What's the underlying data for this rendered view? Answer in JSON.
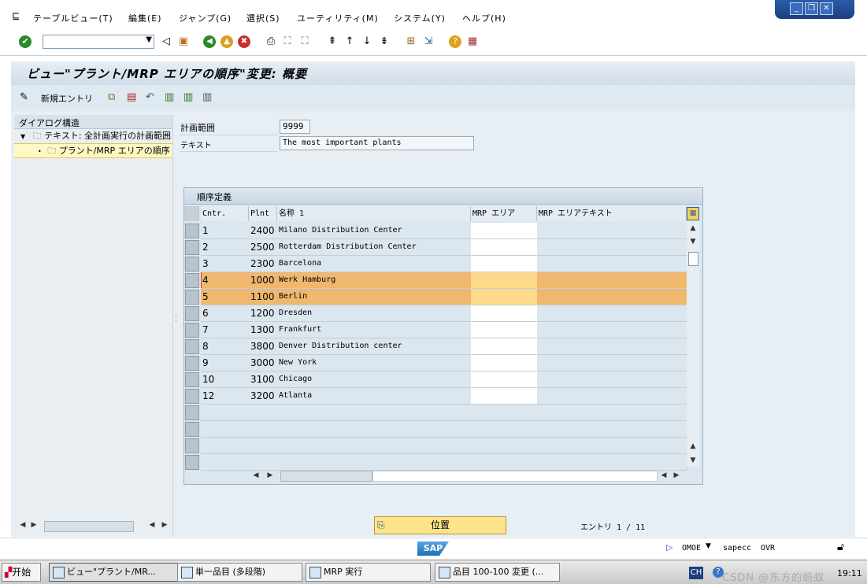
{
  "menu": {
    "items": [
      "テーブルビュー(T)",
      "編集(E)",
      "ジャンプ(G)",
      "選択(S)",
      "ユーティリティ(M)",
      "システム(Y)",
      "ヘルプ(H)"
    ]
  },
  "window_controls": {
    "minimize": "_",
    "restore": "❐",
    "close": "✕"
  },
  "title": "ビュー\"プラント/MRP エリアの順序\"変更: 概要",
  "app_toolbar": {
    "new_entries": "新規エントリ"
  },
  "tree": {
    "header": "ダイアログ構造",
    "items": [
      {
        "label": "テキスト: 全計画実行の計画範囲"
      },
      {
        "label": "プラント/MRP エリアの順序"
      }
    ]
  },
  "fields": {
    "plan_area_label": "計画範囲",
    "plan_area_value": "9999",
    "text_label": "テキスト",
    "text_value": "The most important plants"
  },
  "table": {
    "title": "順序定義",
    "columns": [
      "Cntr.",
      "Plnt",
      "名称 1",
      "MRP エリア",
      "MRP エリアテキスト"
    ],
    "rows": [
      {
        "cntr": "1",
        "plnt": "2400",
        "name": "Milano Distribution Center",
        "mrp": "",
        "mrptext": ""
      },
      {
        "cntr": "2",
        "plnt": "2500",
        "name": "Rotterdam Distribution Center",
        "mrp": "",
        "mrptext": ""
      },
      {
        "cntr": "3",
        "plnt": "2300",
        "name": "Barcelona",
        "mrp": "",
        "mrptext": ""
      },
      {
        "cntr": "4",
        "plnt": "1000",
        "name": "Werk Hamburg",
        "mrp": "",
        "mrptext": ""
      },
      {
        "cntr": "5",
        "plnt": "1100",
        "name": "Berlin",
        "mrp": "",
        "mrptext": ""
      },
      {
        "cntr": "6",
        "plnt": "1200",
        "name": "Dresden",
        "mrp": "",
        "mrptext": ""
      },
      {
        "cntr": "7",
        "plnt": "1300",
        "name": "Frankfurt",
        "mrp": "",
        "mrptext": ""
      },
      {
        "cntr": "8",
        "plnt": "3800",
        "name": "Denver Distribution center",
        "mrp": "",
        "mrptext": ""
      },
      {
        "cntr": "9",
        "plnt": "3000",
        "name": "New York",
        "mrp": "",
        "mrptext": ""
      },
      {
        "cntr": "10",
        "plnt": "3100",
        "name": "Chicago",
        "mrp": "",
        "mrptext": ""
      },
      {
        "cntr": "12",
        "plnt": "3200",
        "name": "Atlanta",
        "mrp": "",
        "mrptext": ""
      }
    ],
    "highlight_color": "#f0b86e",
    "highlight_mrp_color": "#ffd98a"
  },
  "position_button": "位置",
  "entry_count": "エントリ 1 / 11",
  "status": {
    "sap_logo": "SAP",
    "transaction": "OMOE",
    "system": "sapecc",
    "mode": "OVR"
  },
  "taskbar": {
    "start": "开始",
    "tasks": [
      "ビュー\"プラント/MR...",
      "単一品目 (多段階)",
      "MRP 実行",
      "品目 100-100 変更 (..."
    ],
    "lang": "CH",
    "time": "19:11",
    "watermark": "CSDN @东方的蚂蚁"
  }
}
